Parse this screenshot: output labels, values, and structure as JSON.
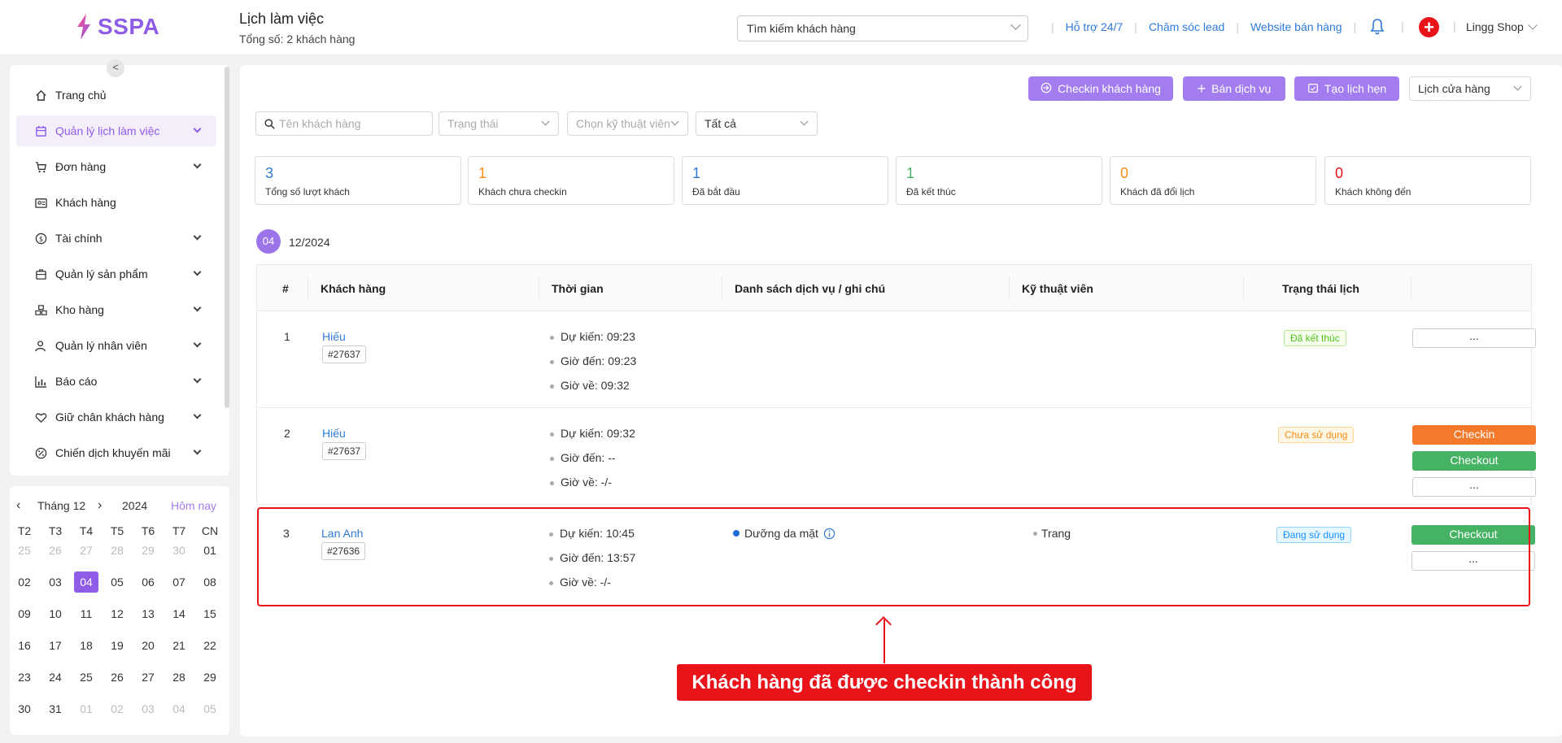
{
  "header": {
    "logo": "SSPA",
    "title": "Lịch làm việc",
    "subtitle": "Tổng số: 2 khách hàng",
    "search_value": "Tìm kiếm khách hàng",
    "links": [
      "Hỗ trợ 24/7",
      "Chăm sóc lead",
      "Website bán hàng"
    ],
    "shop_name": "Lingg Shop",
    "plus": "+"
  },
  "sidebar": {
    "collapse": "<",
    "items": [
      {
        "label": "Trang chủ"
      },
      {
        "label": "Quản lý lịch làm việc"
      },
      {
        "label": "Đơn hàng"
      },
      {
        "label": "Khách hàng"
      },
      {
        "label": "Tài chính"
      },
      {
        "label": "Quản lý sản phẩm"
      },
      {
        "label": "Kho hàng"
      },
      {
        "label": "Quản lý nhân viên"
      },
      {
        "label": "Báo cáo"
      },
      {
        "label": "Giữ chân khách hàng"
      },
      {
        "label": "Chiến dịch khuyến mãi"
      }
    ]
  },
  "calendar": {
    "month": "Tháng 12",
    "year": "2024",
    "today": "Hôm nay",
    "weekdays": [
      "T2",
      "T3",
      "T4",
      "T5",
      "T6",
      "T7",
      "CN"
    ],
    "weeks": [
      [
        "25",
        "26",
        "27",
        "28",
        "29",
        "30",
        "01"
      ],
      [
        "02",
        "03",
        "04",
        "05",
        "06",
        "07",
        "08"
      ],
      [
        "09",
        "10",
        "11",
        "12",
        "13",
        "14",
        "15"
      ],
      [
        "16",
        "17",
        "18",
        "19",
        "20",
        "21",
        "22"
      ],
      [
        "23",
        "24",
        "25",
        "26",
        "27",
        "28",
        "29"
      ],
      [
        "30",
        "31",
        "01",
        "02",
        "03",
        "04",
        "05"
      ]
    ]
  },
  "toolbar": {
    "checkin_label": "Checkin khách hàng",
    "sell_label": "Bán dịch vụ",
    "appointment_label": "Tạo lịch hẹn",
    "store_calendar": "Lịch cửa hàng"
  },
  "filters": {
    "name_placeholder": "Tên khách hàng",
    "status_placeholder": "Trạng thái",
    "tech_placeholder": "Chọn kỹ thuật viên",
    "all_value": "Tất cả"
  },
  "stats": [
    {
      "value": "3",
      "label": "Tổng số lượt khách",
      "color": "#2f7ad9"
    },
    {
      "value": "1",
      "label": "Khách chưa checkin",
      "color": "#fa8c16"
    },
    {
      "value": "1",
      "label": "Đã bắt đầu",
      "color": "#2f7ad9"
    },
    {
      "value": "1",
      "label": "Đã kết thúc",
      "color": "#46b264"
    },
    {
      "value": "0",
      "label": "Khách đã đổi lịch",
      "color": "#fa8c16"
    },
    {
      "value": "0",
      "label": "Khách không đến",
      "color": "#e8141a"
    }
  ],
  "date_group": {
    "day": "04",
    "month": "12/2024"
  },
  "table": {
    "headers": [
      "#",
      "Khách hàng",
      "Thời gian",
      "Danh sách dịch vụ / ghi chú",
      "Kỹ thuật viên",
      "Trạng thái lịch"
    ],
    "time_labels": {
      "expected": "Dự kiến:",
      "arrival": "Giờ đến:",
      "leave": "Giờ về:"
    },
    "rows": [
      {
        "index": "1",
        "name": "Hiếu",
        "code": "#27637",
        "expected": "09:23",
        "arrival": "09:23",
        "leave": "09:32",
        "service": "",
        "technician": "",
        "status": "Đã kết thúc"
      },
      {
        "index": "2",
        "name": "Hiếu",
        "code": "#27637",
        "expected": "09:32",
        "arrival": "--",
        "leave": "-/-",
        "service": "",
        "technician": "",
        "status": "Chưa sử dụng"
      },
      {
        "index": "3",
        "name": "Lan Anh",
        "code": "#27636",
        "expected": "10:45",
        "arrival": "13:57",
        "leave": "-/-",
        "service": "Dưỡng da mặt",
        "technician": "Trang",
        "status": "Đang sử dụng"
      }
    ],
    "actions": {
      "more": "...",
      "checkin": "Checkin",
      "checkout": "Checkout"
    }
  },
  "callout": "Khách hàng đã được checkin thành công",
  "colors": {
    "accent": "#8f5ce8",
    "button": "#a37df0",
    "link": "#2f7ad9",
    "danger": "#e8141a",
    "checkin": "#f5792a",
    "checkout": "#46b264"
  }
}
